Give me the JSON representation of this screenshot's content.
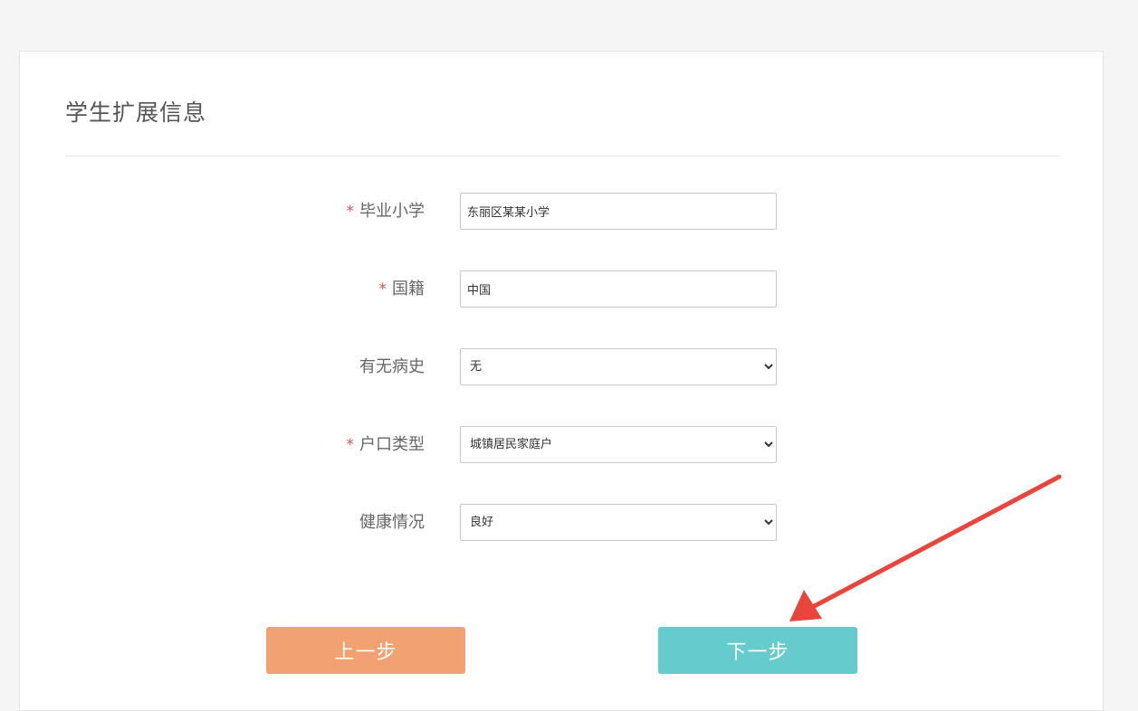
{
  "card": {
    "title": "学生扩展信息"
  },
  "form": {
    "fields": [
      {
        "label": "毕业小学",
        "required": "*",
        "value": "东丽区某某小学"
      },
      {
        "label": "国籍",
        "required": "*",
        "value": "中国"
      },
      {
        "label": "有无病史",
        "required": "",
        "options": [
          "无"
        ],
        "value": "无"
      },
      {
        "label": "户口类型",
        "required": "*",
        "options": [
          "城镇居民家庭户"
        ],
        "value": "城镇居民家庭户"
      },
      {
        "label": "健康情况",
        "required": "",
        "options": [
          "良好"
        ],
        "value": "良好"
      }
    ]
  },
  "buttons": {
    "prev_label": "上一步",
    "next_label": "下一步"
  },
  "colors": {
    "prev_button": "#f2a272",
    "next_button": "#66cbcc",
    "annotation_arrow": "#e8453c",
    "required_star": "#d9534f"
  }
}
